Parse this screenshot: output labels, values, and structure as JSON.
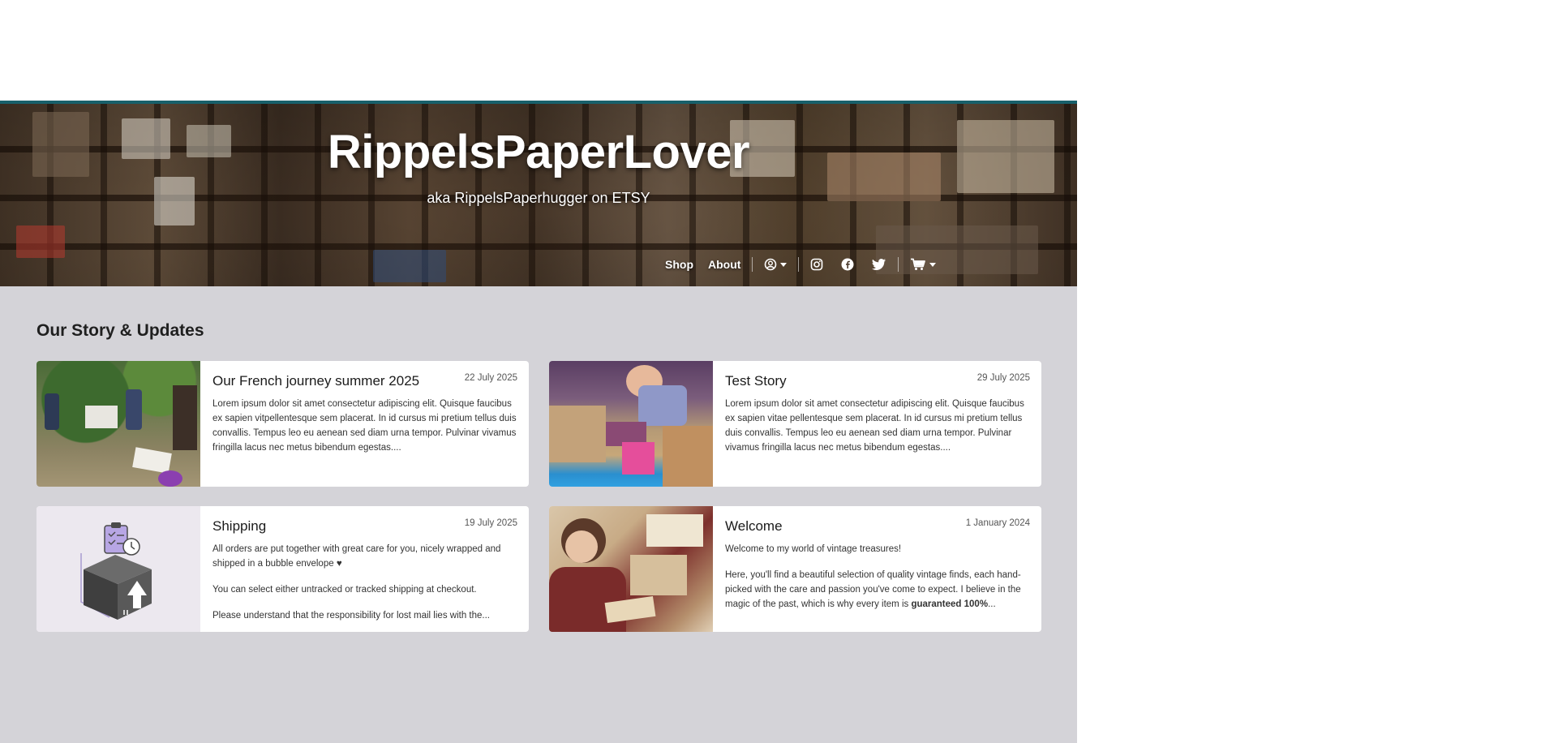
{
  "header": {
    "title": "RippelsPaperLover",
    "subtitle": "aka RippelsPaperhugger on ETSY",
    "accent_color": "#18606b"
  },
  "nav": {
    "shop_label": "Shop",
    "about_label": "About",
    "icons": [
      "account-icon",
      "instagram-icon",
      "facebook-icon",
      "twitter-icon",
      "cart-icon"
    ]
  },
  "stories": {
    "title": "Our Story & Updates",
    "items": [
      {
        "title": "Our French journey summer 2025",
        "date": "22 July 2025",
        "paragraphs": [
          "Lorem ipsum dolor sit amet consectetur adipiscing elit. Quisque faucibus ex sapien vitpellentesque sem placerat. In id cursus mi pretium tellus duis convallis. Tempus leo eu aenean sed diam urna tempor. Pulvinar vivamus fringilla lacus nec metus bibendum egestas...."
        ]
      },
      {
        "title": "Test Story",
        "date": "29 July 2025",
        "paragraphs": [
          "Lorem ipsum dolor sit amet consectetur adipiscing elit. Quisque faucibus ex sapien vitae pellentesque sem placerat. In id cursus mi pretium tellus duis convallis. Tempus leo eu aenean sed diam urna tempor. Pulvinar vivamus fringilla lacus nec metus bibendum egestas...."
        ]
      },
      {
        "title": "Shipping",
        "date": "19 July 2025",
        "paragraphs": [
          "All orders are put together with great care for you, nicely wrapped and shipped in a bubble envelope ♥",
          "You can select either untracked or tracked shipping at checkout.",
          "Please understand that the responsibility for lost mail lies with the..."
        ]
      },
      {
        "title": "Welcome",
        "date": "1 January 2024",
        "paragraphs": [
          "Welcome to my world of vintage treasures!",
          "Here, you'll find a beautiful selection of quality vintage finds, each hand-picked with the care and passion you've come to expect. I believe in the magic of the past, which is why every item is",
          "guaranteed 100%",
          "..."
        ]
      }
    ]
  }
}
